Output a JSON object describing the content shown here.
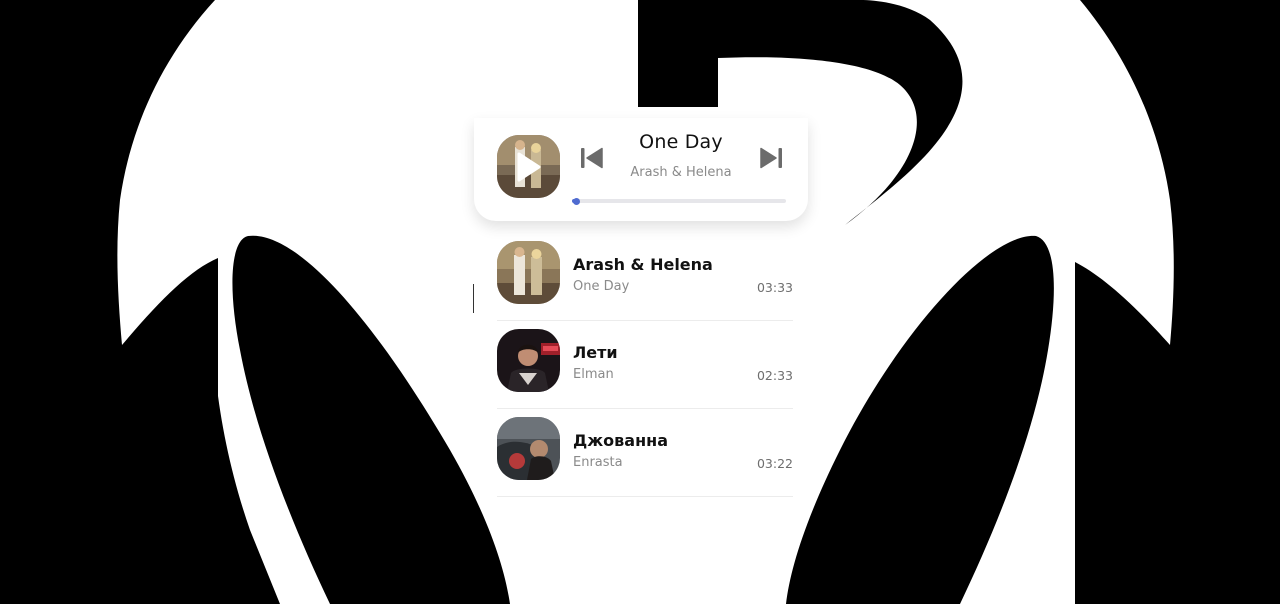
{
  "colors": {
    "accent": "#4f6bd0",
    "background_art": "#000000",
    "title_text": "#111111",
    "muted_text": "#8a8a8a"
  },
  "now_playing": {
    "title": "One Day",
    "artist": "Arash & Helena",
    "progress": 0.02,
    "play_icon": "play-icon",
    "prev_icon": "skip-previous-icon",
    "next_icon": "skip-next-icon"
  },
  "tracks": [
    {
      "title": "Arash & Helena",
      "artist": "One Day",
      "duration": "03:33"
    },
    {
      "title": "Лети",
      "artist": "Elman",
      "duration": "02:33"
    },
    {
      "title": "Джованна",
      "artist": "Enrasta",
      "duration": "03:22"
    }
  ]
}
